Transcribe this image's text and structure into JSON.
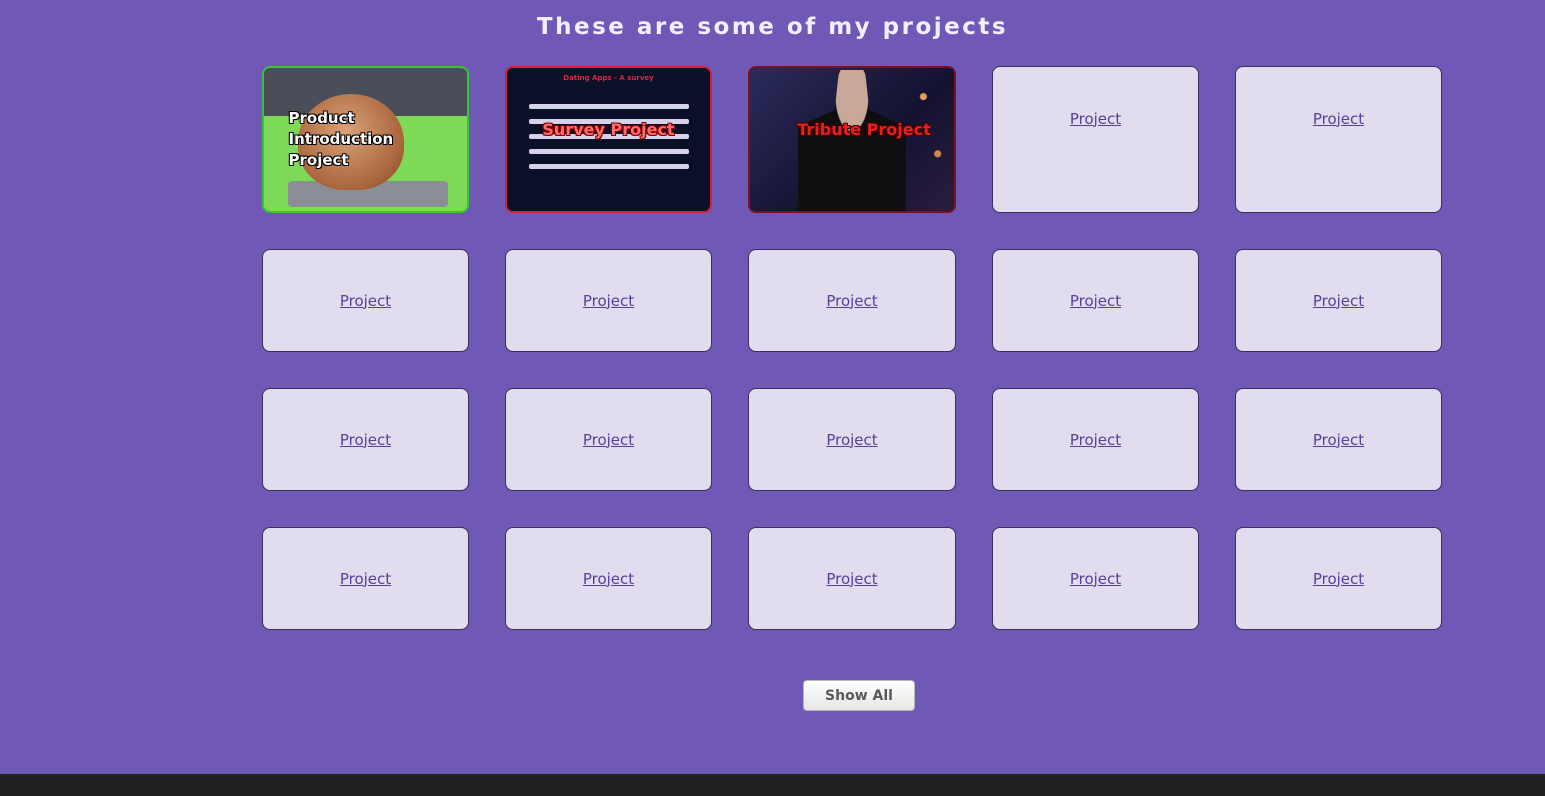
{
  "heading": "These are some of my projects",
  "featured": [
    {
      "label": "Product Introduction Project",
      "border": "#35c53a"
    },
    {
      "label": "Survey Project",
      "border": "#d0213a",
      "thumb_title": "Dating Apps - A survey"
    },
    {
      "label": "Tribute Project",
      "border": "#7a1020"
    }
  ],
  "project_label": "Project",
  "show_all_label": "Show All",
  "colors": {
    "background": "#6f58b6",
    "tile": "#e1dcee",
    "link": "#5a3f9a",
    "footer": "#222023"
  }
}
